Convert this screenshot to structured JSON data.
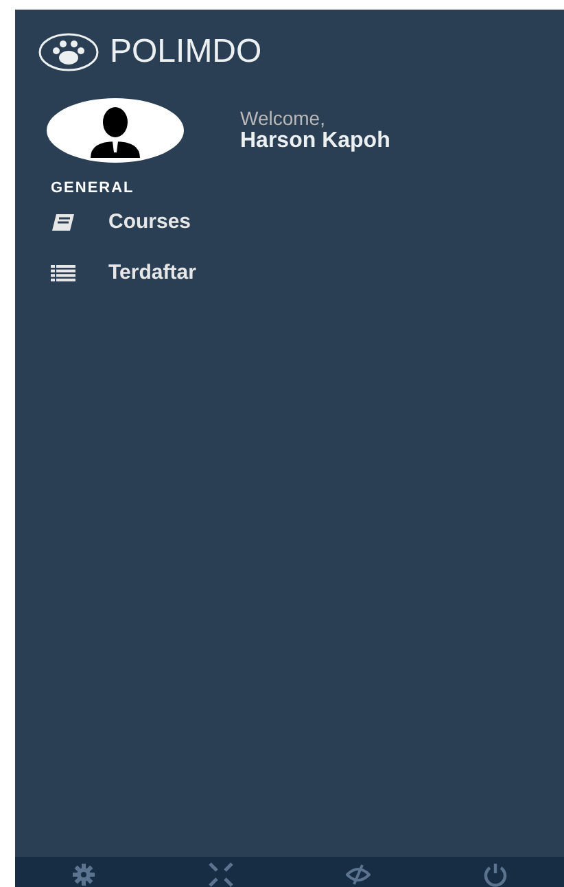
{
  "brand": {
    "title": "POLIMDO"
  },
  "profile": {
    "greeting": "Welcome,",
    "name": "Harson Kapoh"
  },
  "menu": {
    "heading": "GENERAL",
    "items": [
      {
        "kind": "book",
        "label": "Courses"
      },
      {
        "kind": "list",
        "label": "Terdaftar"
      }
    ]
  },
  "footer": {
    "buttons": [
      {
        "kind": "settings"
      },
      {
        "kind": "fullscreen"
      },
      {
        "kind": "hide"
      },
      {
        "kind": "logout"
      }
    ]
  }
}
